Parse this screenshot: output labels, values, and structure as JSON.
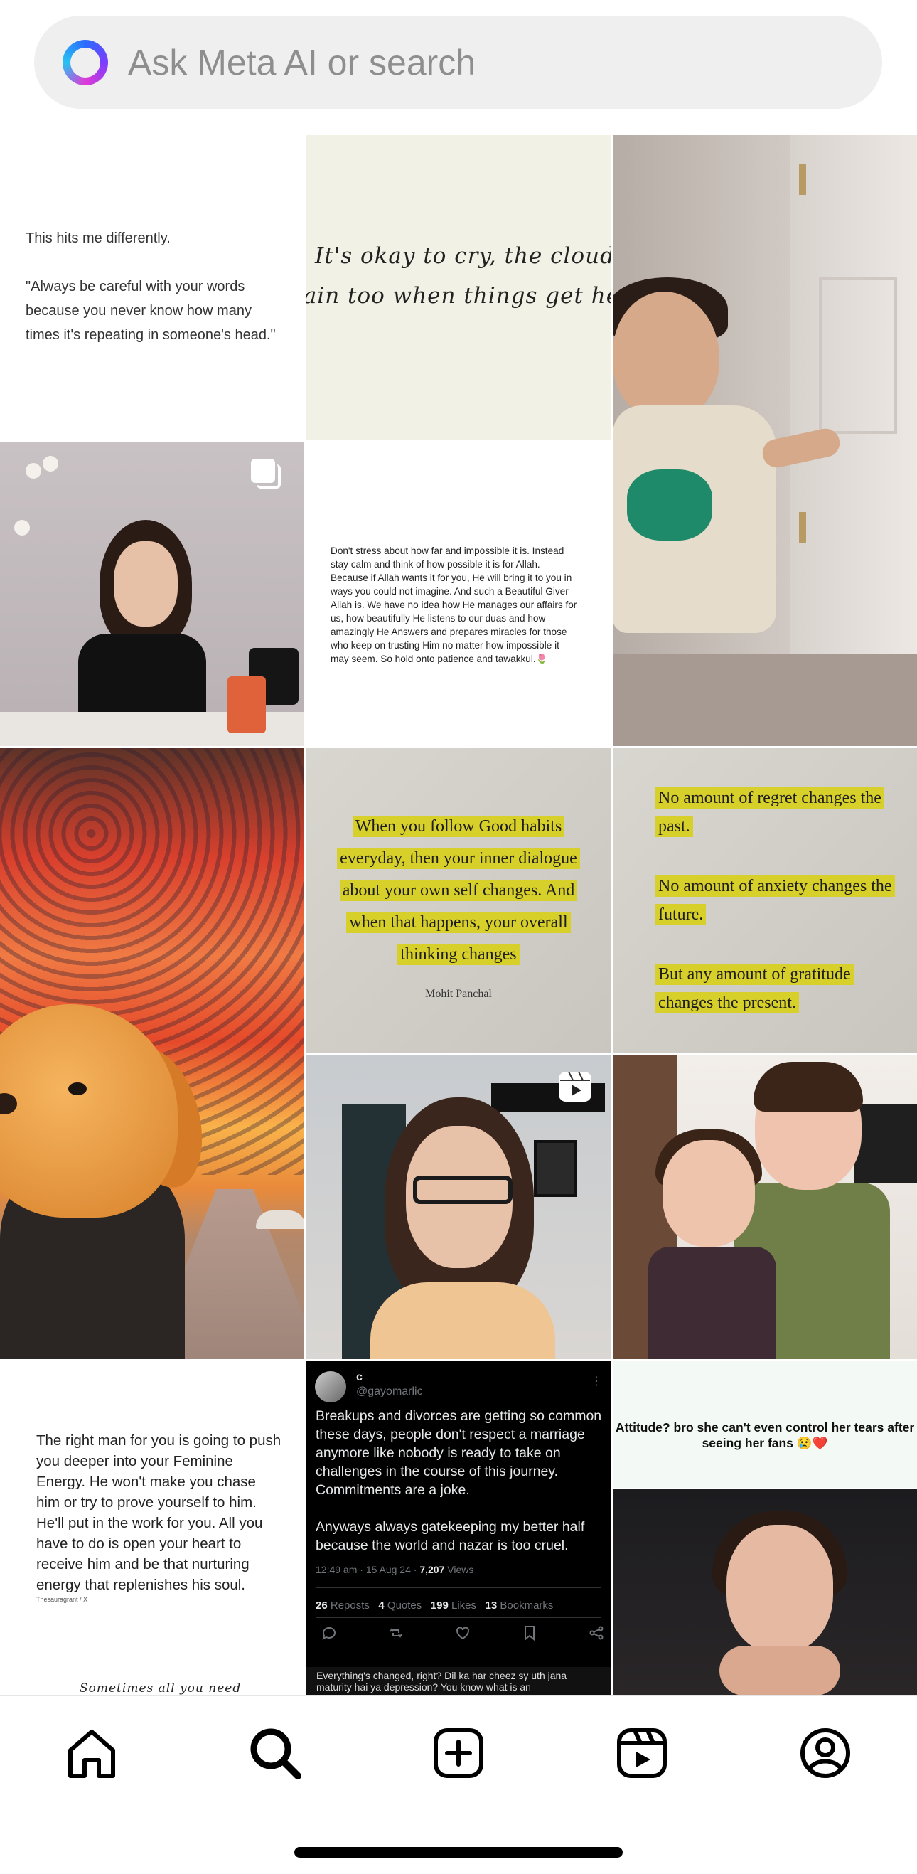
{
  "search": {
    "placeholder": "Ask Meta AI or search",
    "icon": "meta-ai-ring-icon"
  },
  "grid": {
    "quote_careful": {
      "line1": "This hits me differently.",
      "line2": "\"Always be careful with your words because you never know how many times it's repeating in someone's head.\""
    },
    "handwritten": {
      "line1": "It's  okay  to  cry,  the  clouds",
      "line2": "rain  too  when  things  get  heavy"
    },
    "allah_text": "Don't stress about how far and impossible it is. Instead stay calm and think of how possible it is for Allah. Because if Allah wants it for you, He will bring it to you in ways you could not imagine. And such a Beautiful Giver Allah is. We have no idea how He manages our affairs for us, how beautifully He listens to our duas and how amazingly He Answers and prepares miracles for those who keep on trusting Him no matter how impossible it may seem. So hold onto patience and tawakkul.🌷",
    "good_habits": {
      "text": "When you follow Good habits everyday, then your inner dialogue about your own self changes. And when that happens, your overall thinking changes",
      "author": "Mohit Panchal"
    },
    "no_amount": {
      "p1": "No amount of regret changes the past.",
      "p2": "No amount of anxiety changes the future.",
      "p3": "But any amount of gratitude changes the present."
    },
    "right_man": {
      "text": "The right man for you is going to push you deeper into your Feminine Energy. He won't make you chase him or try to prove yourself to him. He'll put in the work for you. All you have to do is open your heart to receive him and be that nurturing energy that replenishes his soul.",
      "source": "Thesauragrant / X",
      "handwritten": "Sometimes  all  you  need"
    },
    "tweet": {
      "name": "c",
      "handle": "@gayomarlic",
      "more": "⋮",
      "p1": "Breakups and divorces are getting so common these days, people don't respect a marriage anymore like nobody is ready to take on challenges in the course of this journey. Commitments are a joke.",
      "p2": "Anyways always gatekeeping my better half because the world and nazar is too cruel.",
      "time": "12:49 am · 15 Aug 24 · ",
      "views": "7,207",
      "views_label": " Views",
      "reposts": "26",
      "reposts_label": " Reposts",
      "quotes": "4",
      "quotes_label": " Quotes",
      "likes": "199",
      "likes_label": " Likes",
      "bookmarks": "13",
      "bookmarks_label": " Bookmarks",
      "next_text": "Everything's changed, right? Dil ka har cheez sy uth jana maturity hai ya depression? You know what is an"
    },
    "attitude": {
      "caption": "Attitude? bro she can't even control her tears after seeing her fans 😢❤️"
    }
  },
  "nav": {
    "items": [
      {
        "name": "home",
        "icon": "home-icon"
      },
      {
        "name": "search",
        "icon": "search-icon",
        "active": true
      },
      {
        "name": "create",
        "icon": "create-plus-icon"
      },
      {
        "name": "reels",
        "icon": "reels-icon"
      },
      {
        "name": "profile",
        "icon": "profile-icon"
      }
    ]
  }
}
